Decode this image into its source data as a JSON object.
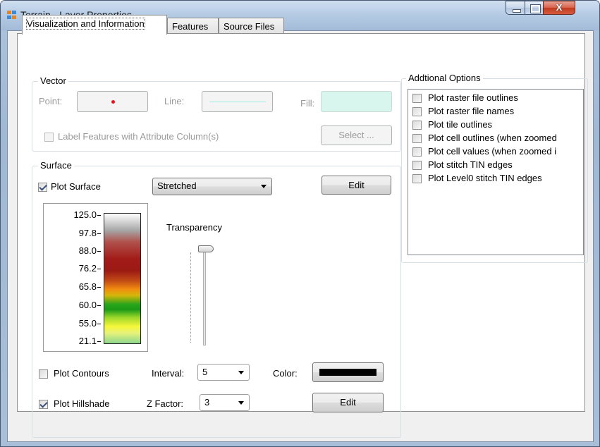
{
  "window": {
    "title": "Terrain - Layer Properties",
    "controls": {
      "minimize": "—",
      "maximize": "□",
      "close": "X"
    }
  },
  "tabs": [
    {
      "label": "Visualization and Information",
      "active": true
    },
    {
      "label": "Features",
      "active": false
    },
    {
      "label": "Source Files",
      "active": false
    }
  ],
  "vector": {
    "group_label": "Vector",
    "point_label": "Point:",
    "line_label": "Line:",
    "fill_label": "Fill:",
    "point_color": "#e8141c",
    "line_color": "#a0efe0",
    "fill_color": "#d8f5ee",
    "label_features": "Label Features with Attribute Column(s)",
    "select_button": "Select ..."
  },
  "surface": {
    "group_label": "Surface",
    "plot_surface": {
      "label": "Plot Surface",
      "checked": true
    },
    "stretch_mode": "Stretched",
    "edit_button": "Edit",
    "transparency_label": "Transparency",
    "transparency_value": 0,
    "legend_values": [
      "125.0",
      "97.8",
      "88.0",
      "76.2",
      "65.8",
      "60.0",
      "55.0",
      "21.1"
    ],
    "plot_contours": {
      "label": "Plot Contours",
      "checked": false
    },
    "interval_label": "Interval:",
    "interval_value": "5",
    "color_label": "Color:",
    "contour_color": "#000000",
    "plot_hillshade": {
      "label": "Plot Hillshade",
      "checked": true
    },
    "z_factor_label": "Z Factor:",
    "z_factor_value": "3",
    "hillshade_edit_button": "Edit"
  },
  "additional_options": {
    "group_label": "Addtional Options",
    "items": [
      {
        "label": "Plot raster file outlines",
        "checked": false
      },
      {
        "label": "Plot raster file names",
        "checked": false
      },
      {
        "label": "Plot tile outlines",
        "checked": false
      },
      {
        "label": "Plot cell outlines (when zoomed",
        "checked": false
      },
      {
        "label": "Plot cell values (when zoomed i",
        "checked": false
      },
      {
        "label": "Plot stitch TIN edges",
        "checked": false
      },
      {
        "label": "Plot Level0 stitch TIN edges",
        "checked": false
      }
    ]
  }
}
